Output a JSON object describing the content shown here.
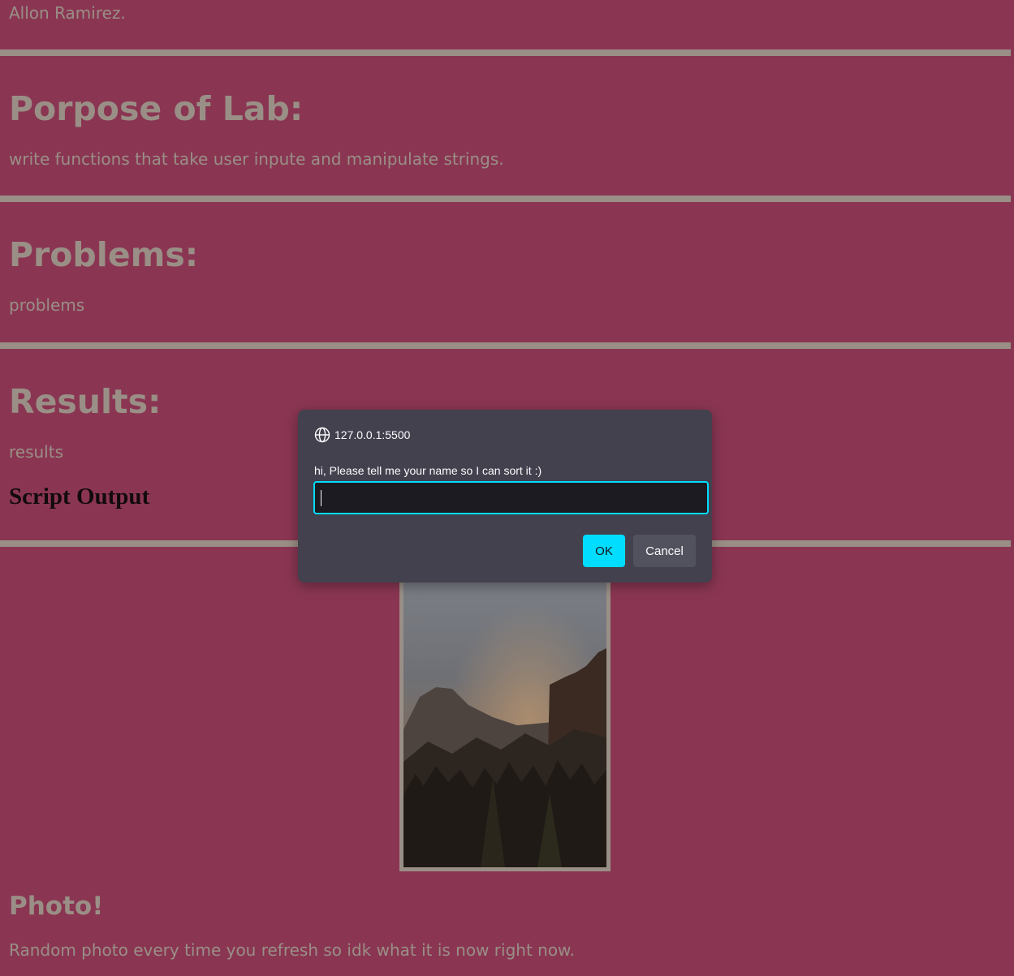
{
  "page": {
    "author_line": "Allon Ramirez.",
    "purpose_heading": "Porpose of Lab:",
    "purpose_text": "write functions that take user inpute and manipulate strings.",
    "problems_heading": "Problems:",
    "problems_text": "problems",
    "results_heading": "Results:",
    "results_text": "results",
    "script_output_heading": "Script Output",
    "photo_heading": "Photo!",
    "photo_text": "Random photo every time you refresh so idk what it is now right now."
  },
  "dialog": {
    "origin": "127.0.0.1:5500",
    "message": "hi, Please tell me your name so I can sort it :)",
    "input_value": "",
    "ok_label": "OK",
    "cancel_label": "Cancel"
  },
  "colors": {
    "background": "#8a3653",
    "text": "#9a8f86",
    "rule": "#9a8f86",
    "dialog_bg": "#42414d",
    "accent": "#00ddff"
  },
  "icons": {
    "origin": "globe-icon"
  }
}
